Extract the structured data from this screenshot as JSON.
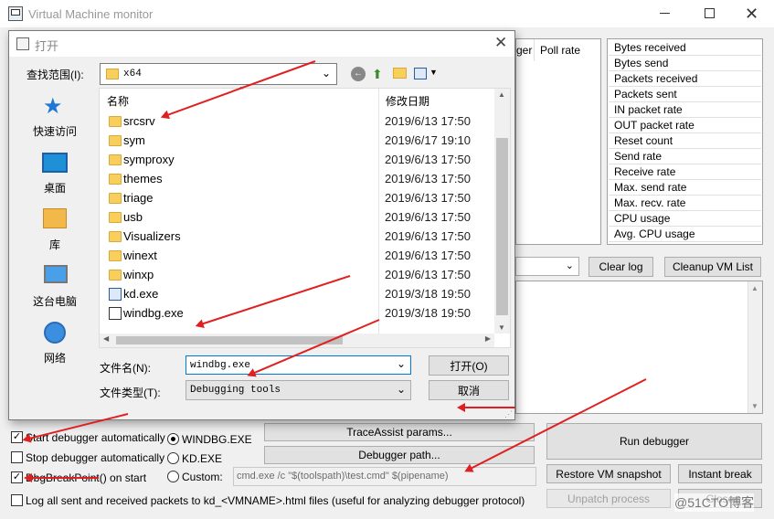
{
  "window": {
    "title": "Virtual Machine monitor"
  },
  "header_cols": {
    "col1": "ger",
    "col2": "Poll rate"
  },
  "stats": [
    "Bytes received",
    "Bytes send",
    "Packets received",
    "Packets sent",
    "IN packet rate",
    "OUT packet rate",
    "Reset count",
    "Send rate",
    "Receive rate",
    "Max. send rate",
    "Max. recv. rate",
    "CPU usage",
    "Avg. CPU usage"
  ],
  "log_buttons": {
    "clear": "Clear log",
    "cleanup": "Cleanup VM List"
  },
  "options": {
    "start_auto": "Start debugger automatically",
    "stop_auto": "Stop debugger automatically",
    "dbgbreak": "DbgBreakPoint() on start",
    "log_all": "Log all sent and received packets to kd_<VMNAME>.html files (useful for analyzing debugger protocol)"
  },
  "debugger": {
    "windbg": "WINDBG.EXE",
    "kd": "KD.EXE",
    "custom": "Custom:",
    "custom_cmd": "cmd.exe /c \"$(toolspath)\\test.cmd\" $(pipename)"
  },
  "buttons": {
    "traceassist": "TraceAssist params...",
    "debugger_path": "Debugger path...",
    "run": "Run debugger",
    "restore": "Restore VM snapshot",
    "instant": "Instant break",
    "unpatch": "Unpatch process",
    "close": "Close"
  },
  "watermark": "@51CTO博客",
  "dialog": {
    "title": "打开",
    "look_in_label": "查找范围(I):",
    "look_in_value": "x64",
    "places": [
      "快速访问",
      "桌面",
      "库",
      "这台电脑",
      "网络"
    ],
    "col_name": "名称",
    "col_date": "修改日期",
    "files": [
      {
        "name": "srcsrv",
        "date": "2019/6/13 17:50",
        "type": "folder"
      },
      {
        "name": "sym",
        "date": "2019/6/17 19:10",
        "type": "folder"
      },
      {
        "name": "symproxy",
        "date": "2019/6/13 17:50",
        "type": "folder"
      },
      {
        "name": "themes",
        "date": "2019/6/13 17:50",
        "type": "folder"
      },
      {
        "name": "triage",
        "date": "2019/6/13 17:50",
        "type": "folder"
      },
      {
        "name": "usb",
        "date": "2019/6/13 17:50",
        "type": "folder"
      },
      {
        "name": "Visualizers",
        "date": "2019/6/13 17:50",
        "type": "folder"
      },
      {
        "name": "winext",
        "date": "2019/6/13 17:50",
        "type": "folder"
      },
      {
        "name": "winxp",
        "date": "2019/6/13 17:50",
        "type": "folder"
      },
      {
        "name": "kd.exe",
        "date": "2019/3/18 19:50",
        "type": "exe"
      },
      {
        "name": "windbg.exe",
        "date": "2019/3/18 19:50",
        "type": "windbg"
      }
    ],
    "filename_label": "文件名(N):",
    "filename_value": "windbg.exe",
    "filetype_label": "文件类型(T):",
    "filetype_value": "Debugging tools",
    "open_btn": "打开(O)",
    "cancel_btn": "取消"
  }
}
